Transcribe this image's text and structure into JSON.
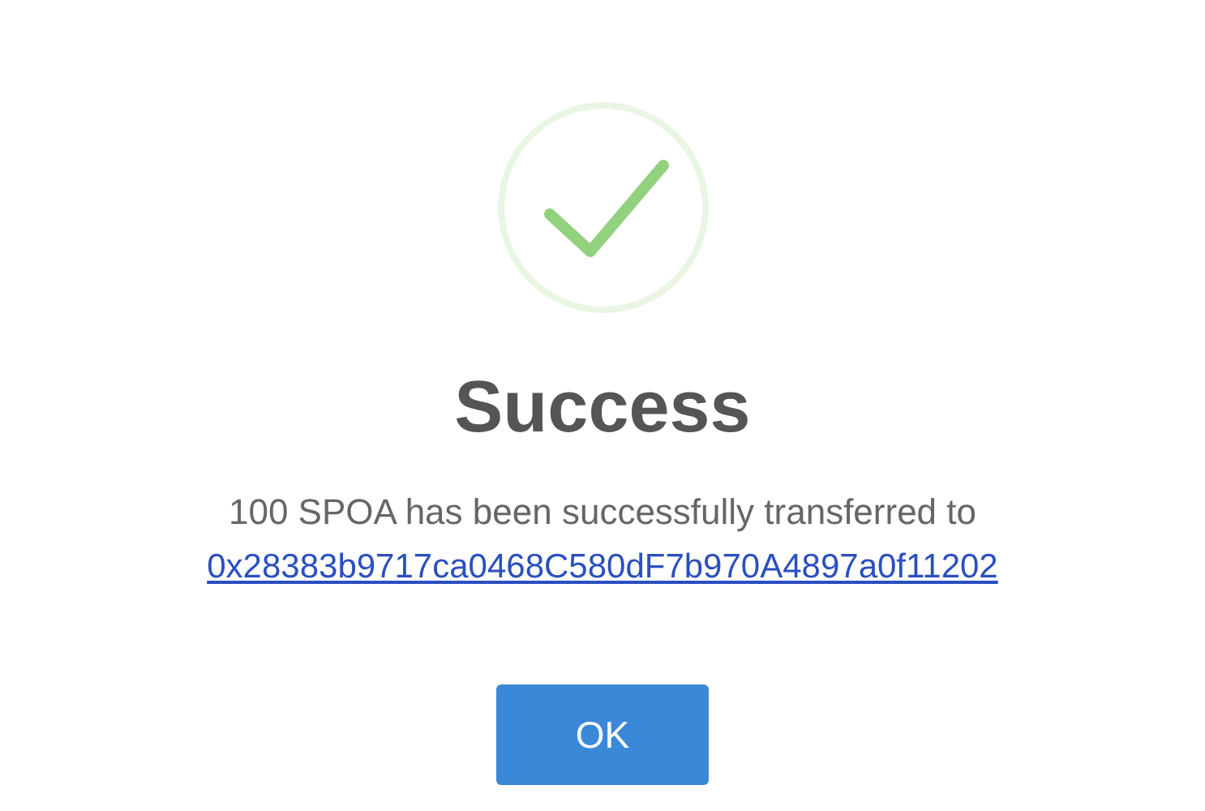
{
  "dialog": {
    "title": "Success",
    "message": "100 SPOA has been successfully transferred to",
    "address_link": "0x28383b9717ca0468C580dF7b970A4897a0f11202",
    "buttons": [
      "OK"
    ]
  }
}
